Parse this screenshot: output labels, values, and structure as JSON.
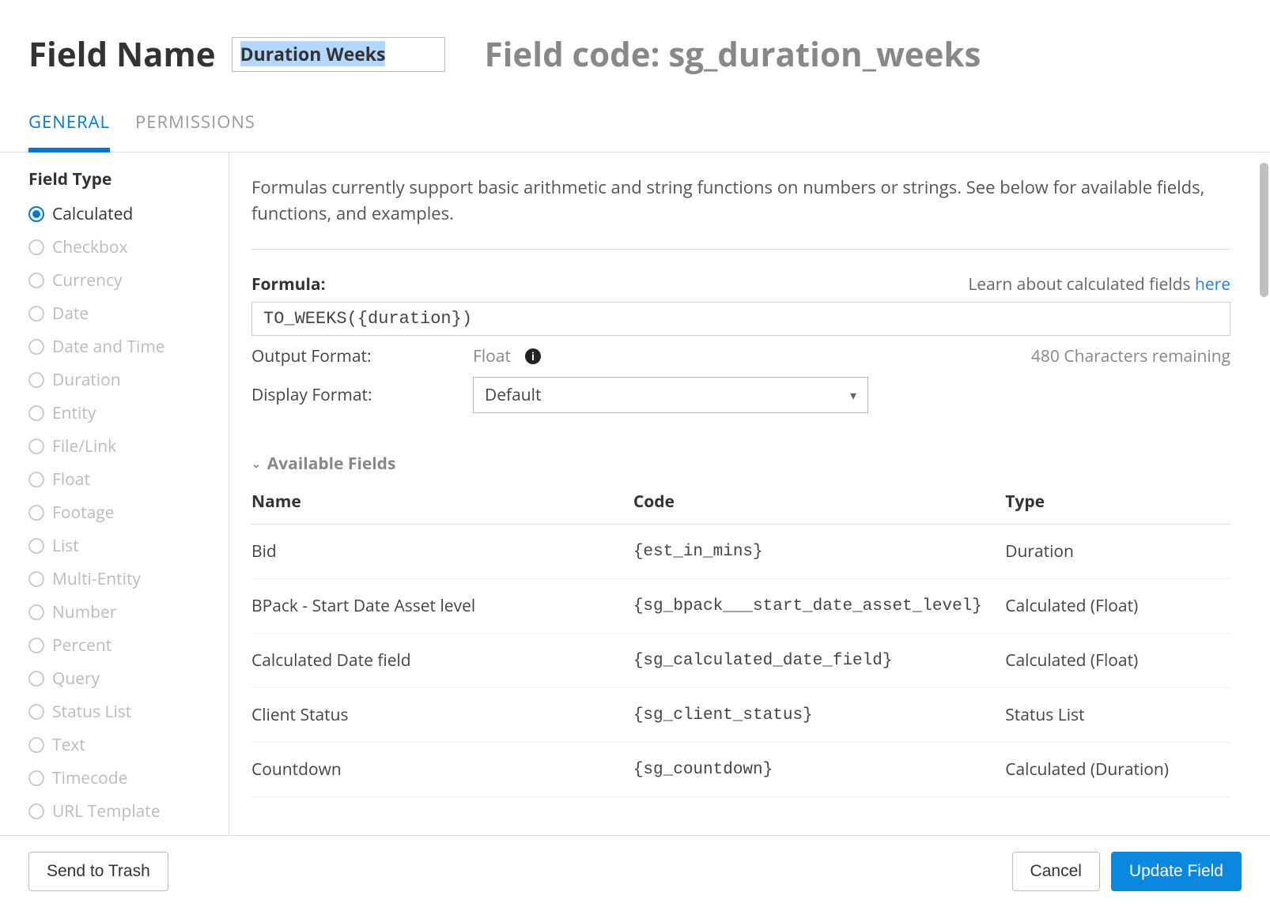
{
  "header": {
    "label": "Field Name",
    "field_name_value": "Duration Weeks",
    "field_code_label": "Field code: sg_duration_weeks"
  },
  "tabs": {
    "general": "GENERAL",
    "permissions": "PERMISSIONS"
  },
  "sidebar": {
    "title": "Field Type",
    "items": [
      {
        "label": "Calculated",
        "selected": true
      },
      {
        "label": "Checkbox"
      },
      {
        "label": "Currency"
      },
      {
        "label": "Date"
      },
      {
        "label": "Date and Time"
      },
      {
        "label": "Duration"
      },
      {
        "label": "Entity"
      },
      {
        "label": "File/Link"
      },
      {
        "label": "Float"
      },
      {
        "label": "Footage"
      },
      {
        "label": "List"
      },
      {
        "label": "Multi-Entity"
      },
      {
        "label": "Number"
      },
      {
        "label": "Percent"
      },
      {
        "label": "Query"
      },
      {
        "label": "Status List"
      },
      {
        "label": "Text"
      },
      {
        "label": "Timecode"
      },
      {
        "label": "URL Template"
      }
    ]
  },
  "main": {
    "intro": "Formulas currently support basic arithmetic and string functions on numbers or strings. See below for available fields, functions, and examples.",
    "formula_label": "Formula:",
    "learn_text": "Learn about calculated fields ",
    "learn_link": "here",
    "formula_value": "TO_WEEKS({duration})",
    "output_label": "Output Format:",
    "output_value": "Float",
    "chars_remaining": "480 Characters remaining",
    "display_label": "Display Format:",
    "display_value": "Default",
    "available_fields_title": "Available Fields",
    "table": {
      "headers": {
        "name": "Name",
        "code": "Code",
        "type": "Type"
      },
      "rows": [
        {
          "name": "Bid",
          "code": "{est_in_mins}",
          "type": "Duration"
        },
        {
          "name": "BPack - Start Date Asset level",
          "code": "{sg_bpack___start_date_asset_level}",
          "type": "Calculated (Float)"
        },
        {
          "name": "Calculated Date field",
          "code": "{sg_calculated_date_field}",
          "type": "Calculated (Float)"
        },
        {
          "name": "Client Status",
          "code": "{sg_client_status}",
          "type": "Status List"
        },
        {
          "name": "Countdown",
          "code": "{sg_countdown}",
          "type": "Calculated (Duration)"
        }
      ]
    }
  },
  "footer": {
    "trash": "Send to Trash",
    "cancel": "Cancel",
    "update": "Update Field"
  }
}
